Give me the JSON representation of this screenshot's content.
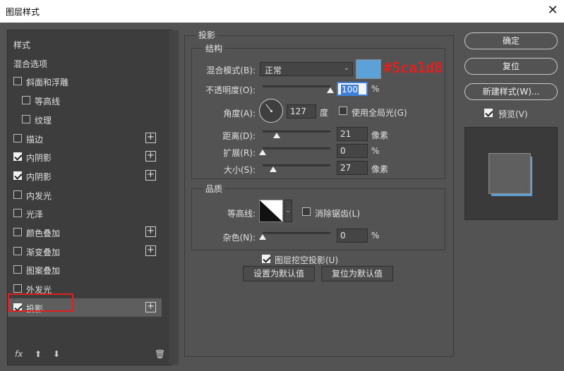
{
  "window": {
    "title": "图层样式",
    "close_glyph": "✕"
  },
  "left_panel": {
    "items": [
      {
        "label": "样式",
        "has_checkbox": false,
        "checked": false,
        "has_plus": false,
        "indent": 0
      },
      {
        "label": "混合选项",
        "has_checkbox": false,
        "checked": false,
        "has_plus": false,
        "indent": 0
      },
      {
        "label": "斜面和浮雕",
        "has_checkbox": true,
        "checked": false,
        "has_plus": false,
        "indent": 0
      },
      {
        "label": "等高线",
        "has_checkbox": true,
        "checked": false,
        "has_plus": false,
        "indent": 1
      },
      {
        "label": "纹理",
        "has_checkbox": true,
        "checked": false,
        "has_plus": false,
        "indent": 1
      },
      {
        "label": "描边",
        "has_checkbox": true,
        "checked": false,
        "has_plus": true,
        "indent": 0
      },
      {
        "label": "内阴影",
        "has_checkbox": true,
        "checked": true,
        "has_plus": true,
        "indent": 0
      },
      {
        "label": "内阴影",
        "has_checkbox": true,
        "checked": true,
        "has_plus": true,
        "indent": 0
      },
      {
        "label": "内发光",
        "has_checkbox": true,
        "checked": false,
        "has_plus": false,
        "indent": 0
      },
      {
        "label": "光泽",
        "has_checkbox": true,
        "checked": false,
        "has_plus": false,
        "indent": 0
      },
      {
        "label": "颜色叠加",
        "has_checkbox": true,
        "checked": false,
        "has_plus": true,
        "indent": 0
      },
      {
        "label": "渐变叠加",
        "has_checkbox": true,
        "checked": false,
        "has_plus": true,
        "indent": 0
      },
      {
        "label": "图案叠加",
        "has_checkbox": true,
        "checked": false,
        "has_plus": false,
        "indent": 0
      },
      {
        "label": "外发光",
        "has_checkbox": true,
        "checked": false,
        "has_plus": false,
        "indent": 0
      },
      {
        "label": "投影",
        "has_checkbox": true,
        "checked": true,
        "has_plus": true,
        "indent": 0,
        "selected": true
      }
    ],
    "footer": {
      "fx": "fx",
      "up": "⬆",
      "down": "⬇",
      "trash": "🗑"
    }
  },
  "drop_shadow": {
    "section_title": "投影",
    "structure": {
      "title": "结构",
      "blend_mode_label": "混合模式(B):",
      "blend_mode_value": "正常",
      "color_hex_label": "#5ca1d8",
      "color": "#5ca1d8",
      "opacity_label": "不透明度(O):",
      "opacity_value": "100",
      "opacity_unit": "%",
      "opacity": 100,
      "angle_label": "角度(A):",
      "angle_value": "127",
      "angle_unit": "度",
      "global_light_label": "使用全局光(G)",
      "global_light_checked": false,
      "distance_label": "距离(D):",
      "distance_value": "21",
      "distance_unit": "像素",
      "distance": 21,
      "spread_label": "扩展(R):",
      "spread_value": "0",
      "spread_unit": "%",
      "spread": 0,
      "size_label": "大小(S):",
      "size_value": "27",
      "size_unit": "像素",
      "size": 27
    },
    "quality": {
      "title": "品质",
      "contour_label": "等高线:",
      "antialias_label": "消除锯齿(L)",
      "antialias_checked": false,
      "noise_label": "杂色(N):",
      "noise_value": "0",
      "noise_unit": "%",
      "noise": 0
    },
    "knockout_label": "图层挖空投影(U)",
    "knockout_checked": true,
    "set_default": "设置为默认值",
    "reset_default": "复位为默认值"
  },
  "right_panel": {
    "ok": "确定",
    "reset": "复位",
    "new_style": "新建样式(W)...",
    "preview_label": "预览(V)",
    "preview_checked": true
  }
}
